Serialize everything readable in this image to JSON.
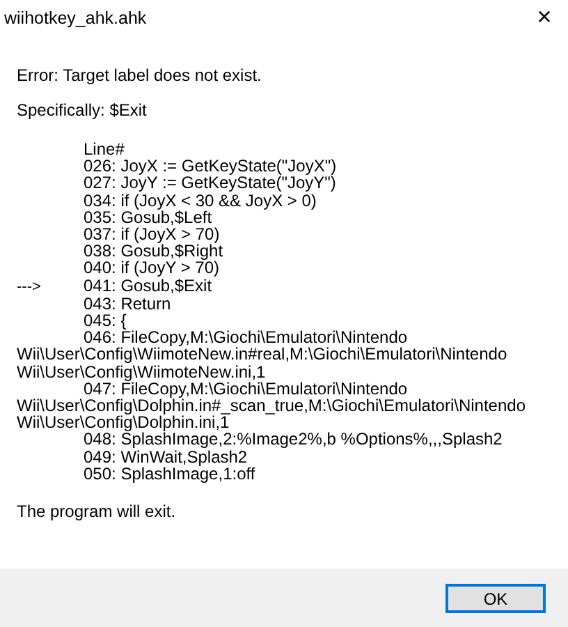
{
  "window": {
    "title": "wiihotkey_ahk.ahk",
    "close": "✕"
  },
  "message": {
    "error": "Error:  Target label does not exist.",
    "specifically": "Specifically: $Exit",
    "listing": [
      {
        "lines": [
          "Line#"
        ]
      },
      {
        "lines": [
          "026: JoyX := GetKeyState(\"JoyX\")"
        ]
      },
      {
        "lines": [
          "027: JoyY := GetKeyState(\"JoyY\")"
        ]
      },
      {
        "lines": [
          "034: if (JoyX < 30 && JoyX > 0)"
        ]
      },
      {
        "lines": [
          "035: Gosub,$Left"
        ]
      },
      {
        "lines": [
          "037: if (JoyX > 70)"
        ]
      },
      {
        "lines": [
          "038: Gosub,$Right"
        ]
      },
      {
        "lines": [
          "040: if (JoyY > 70)"
        ]
      },
      {
        "lines": [
          "041: Gosub,$Exit"
        ],
        "marker": "--->"
      },
      {
        "lines": [
          "043: Return"
        ]
      },
      {
        "lines": [
          "045: {"
        ]
      },
      {
        "lines": [
          "046: FileCopy,M:\\Giochi\\Emulatori\\Nintendo",
          "Wii\\User\\Config\\WiimoteNew.in#real,M:\\Giochi\\Emulatori\\Nintendo",
          "Wii\\User\\Config\\WiimoteNew.ini,1"
        ]
      },
      {
        "lines": [
          "047: FileCopy,M:\\Giochi\\Emulatori\\Nintendo",
          "Wii\\User\\Config\\Dolphin.in#_scan_true,M:\\Giochi\\Emulatori\\Nintendo",
          "Wii\\User\\Config\\Dolphin.ini,1"
        ]
      },
      {
        "lines": [
          "048: SplashImage,2:%Image2%,b %Options%,,,Splash2"
        ]
      },
      {
        "lines": [
          "049: WinWait,Splash2"
        ]
      },
      {
        "lines": [
          "050: SplashImage,1:off"
        ]
      }
    ],
    "footer": "The program will exit."
  },
  "buttons": [
    {
      "label": "OK",
      "selected": true
    }
  ]
}
